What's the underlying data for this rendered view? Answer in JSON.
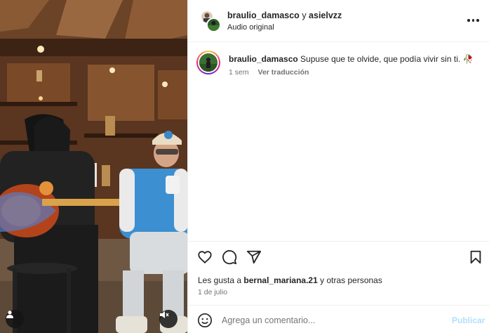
{
  "header": {
    "user1": "braulio_damasco",
    "connector": "y",
    "user2": "asielvzz",
    "subtitle": "Audio original",
    "more_icon": "more-horizontal-icon"
  },
  "comment": {
    "username": "braulio_damasco",
    "text": "Supuse que te olvide, que podía vivir sin ti.",
    "emoji": "🥀",
    "time": "1 sem",
    "translate_label": "Ver traducción"
  },
  "actions": {
    "icons": [
      "heart-icon",
      "comment-icon",
      "share-icon",
      "bookmark-icon"
    ],
    "likes_prefix": "Les gusta a",
    "likes_user": "bernal_mariana.21",
    "likes_suffix": "y otras personas",
    "date": "1 de julio"
  },
  "composer": {
    "placeholder": "Agrega un comentario...",
    "post_label": "Publicar",
    "post_color": "#b2dffc"
  },
  "media": {
    "buttons": [
      "user-tag-icon",
      "muted-speaker-icon"
    ]
  }
}
